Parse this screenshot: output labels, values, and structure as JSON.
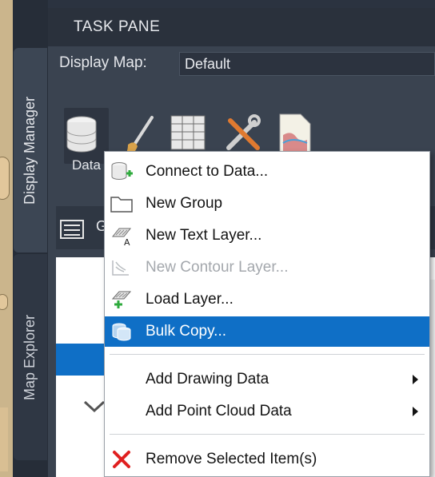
{
  "pane": {
    "title": "TASK PANE",
    "display_map_label": "Display Map:",
    "display_map_value": "Default"
  },
  "tabs": [
    {
      "label": "Display Manager",
      "active": true
    },
    {
      "label": "Map Explorer",
      "active": false
    }
  ],
  "toolbar": {
    "data_label": "Data",
    "icons": [
      "database-icon",
      "style-brush-icon",
      "table-icon",
      "tools-icon",
      "map-document-icon"
    ]
  },
  "layers_bar": {
    "partial_label": "G"
  },
  "context_menu": {
    "items": [
      {
        "label": "Connect to Data...",
        "icon": "connect-data-icon",
        "enabled": true
      },
      {
        "label": "New Group",
        "icon": "folder-icon",
        "enabled": true
      },
      {
        "label": "New Text Layer...",
        "icon": "text-layer-icon",
        "enabled": true
      },
      {
        "label": "New Contour Layer...",
        "icon": "contour-layer-icon",
        "enabled": false
      },
      {
        "label": "Load Layer...",
        "icon": "load-layer-icon",
        "enabled": true
      },
      {
        "label": "Bulk Copy...",
        "icon": "bulk-copy-icon",
        "enabled": true,
        "highlighted": true
      },
      {
        "label": "Add Drawing Data",
        "icon": "",
        "enabled": true,
        "submenu": true
      },
      {
        "label": "Add Point Cloud Data",
        "icon": "",
        "enabled": true,
        "submenu": true
      },
      {
        "label": "Remove Selected Item(s)",
        "icon": "remove-red-x-icon",
        "enabled": true
      }
    ]
  },
  "colors": {
    "highlight": "#0f6fc6",
    "pane_bg": "#3a4350",
    "title_bar": "#2a313c",
    "remove_icon": "#e02020",
    "add_icon": "#2eaa3c"
  }
}
